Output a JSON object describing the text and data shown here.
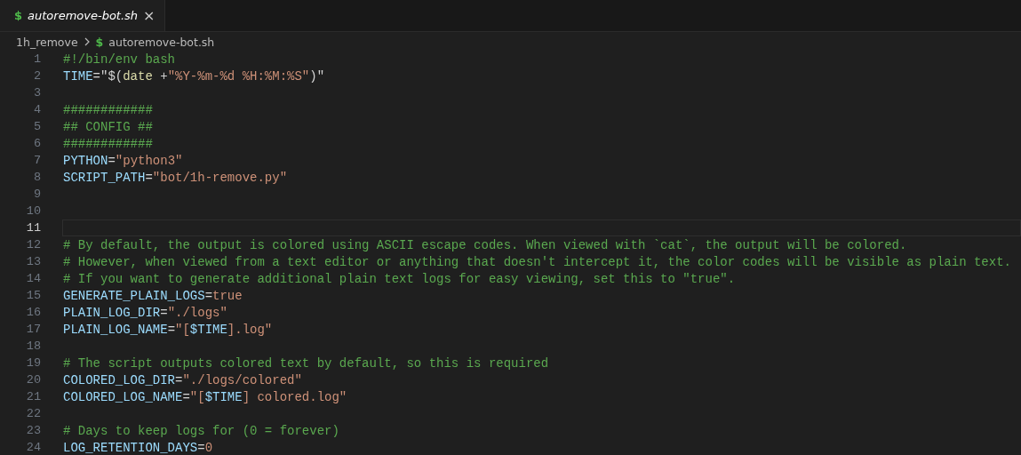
{
  "tabs": [
    {
      "icon_glyph": "$",
      "label": "autoremove-bot.sh",
      "preview": true,
      "selected": true,
      "close": "×"
    }
  ],
  "breadcrumb": [
    {
      "kind": "folder",
      "label": "1h_remove"
    },
    {
      "kind": "file",
      "icon_glyph": "$",
      "label": "autoremove-bot.sh"
    }
  ],
  "lines": [
    {
      "number": "1",
      "current": false,
      "tokens": [
        {
          "kind": "comment",
          "text": "#!/bin/env bash"
        }
      ]
    },
    {
      "number": "2",
      "current": false,
      "tokens": [
        {
          "kind": "var",
          "text": "TIME"
        },
        {
          "kind": "op",
          "text": "=\"$("
        },
        {
          "kind": "fn",
          "text": "date"
        },
        {
          "kind": "op",
          "text": " +"
        },
        {
          "kind": "str",
          "text": "\"%Y-%m-%d %H:%M:%S\""
        },
        {
          "kind": "op",
          "text": ")\""
        }
      ]
    },
    {
      "number": "3",
      "current": false
    },
    {
      "number": "4",
      "current": false,
      "tokens": [
        {
          "kind": "comment",
          "text": "############"
        }
      ]
    },
    {
      "number": "5",
      "current": false,
      "tokens": [
        {
          "kind": "comment",
          "text": "## CONFIG ##"
        }
      ]
    },
    {
      "number": "6",
      "current": false,
      "tokens": [
        {
          "kind": "comment",
          "text": "############"
        }
      ]
    },
    {
      "number": "7",
      "current": false,
      "tokens": [
        {
          "kind": "var",
          "text": "PYTHON"
        },
        {
          "kind": "op",
          "text": "="
        },
        {
          "kind": "str",
          "text": "\"python3\""
        }
      ]
    },
    {
      "number": "8",
      "current": false,
      "tokens": [
        {
          "kind": "var",
          "text": "SCRIPT_PATH"
        },
        {
          "kind": "op",
          "text": "="
        },
        {
          "kind": "str",
          "text": "\"bot/1h-remove.py\""
        }
      ]
    },
    {
      "number": "9",
      "current": false
    },
    {
      "number": "10",
      "current": false
    },
    {
      "number": "11",
      "current": true
    },
    {
      "number": "12",
      "current": false,
      "tokens": [
        {
          "kind": "comment",
          "text": "# By default, the output is colored using ASCII escape codes. When viewed with `cat`, the output will be colored."
        }
      ]
    },
    {
      "number": "13",
      "current": false,
      "tokens": [
        {
          "kind": "comment",
          "text": "# However, when viewed from a text editor or anything that doesn't intercept it, the color codes will be visible as plain text."
        }
      ]
    },
    {
      "number": "14",
      "current": false,
      "tokens": [
        {
          "kind": "comment",
          "text": "# If you want to generate additional plain text logs for easy viewing, set this to \"true\"."
        }
      ]
    },
    {
      "number": "15",
      "current": false,
      "tokens": [
        {
          "kind": "var",
          "text": "GENERATE_PLAIN_LOGS"
        },
        {
          "kind": "op",
          "text": "="
        },
        {
          "kind": "str",
          "text": "true"
        }
      ]
    },
    {
      "number": "16",
      "current": false,
      "tokens": [
        {
          "kind": "var",
          "text": "PLAIN_LOG_DIR"
        },
        {
          "kind": "op",
          "text": "="
        },
        {
          "kind": "str",
          "text": "\"./logs\""
        }
      ]
    },
    {
      "number": "17",
      "current": false,
      "tokens": [
        {
          "kind": "var",
          "text": "PLAIN_LOG_NAME"
        },
        {
          "kind": "op",
          "text": "="
        },
        {
          "kind": "str",
          "text": "\"["
        },
        {
          "kind": "var",
          "text": "$TIME"
        },
        {
          "kind": "str",
          "text": "].log\""
        }
      ]
    },
    {
      "number": "18",
      "current": false
    },
    {
      "number": "19",
      "current": false,
      "tokens": [
        {
          "kind": "comment",
          "text": "# The script outputs colored text by default, so this is required"
        }
      ]
    },
    {
      "number": "20",
      "current": false,
      "tokens": [
        {
          "kind": "var",
          "text": "COLORED_LOG_DIR"
        },
        {
          "kind": "op",
          "text": "="
        },
        {
          "kind": "str",
          "text": "\"./logs/colored\""
        }
      ]
    },
    {
      "number": "21",
      "current": false,
      "tokens": [
        {
          "kind": "var",
          "text": "COLORED_LOG_NAME"
        },
        {
          "kind": "op",
          "text": "="
        },
        {
          "kind": "str",
          "text": "\"["
        },
        {
          "kind": "var",
          "text": "$TIME"
        },
        {
          "kind": "str",
          "text": "] colored.log\""
        }
      ]
    },
    {
      "number": "22",
      "current": false
    },
    {
      "number": "23",
      "current": false,
      "tokens": [
        {
          "kind": "comment",
          "text": "# Days to keep logs for (0 = forever)"
        }
      ]
    },
    {
      "number": "24",
      "current": false,
      "tokens": [
        {
          "kind": "var",
          "text": "LOG_RETENTION_DAYS"
        },
        {
          "kind": "op",
          "text": "="
        },
        {
          "kind": "str",
          "text": "0"
        }
      ]
    }
  ]
}
